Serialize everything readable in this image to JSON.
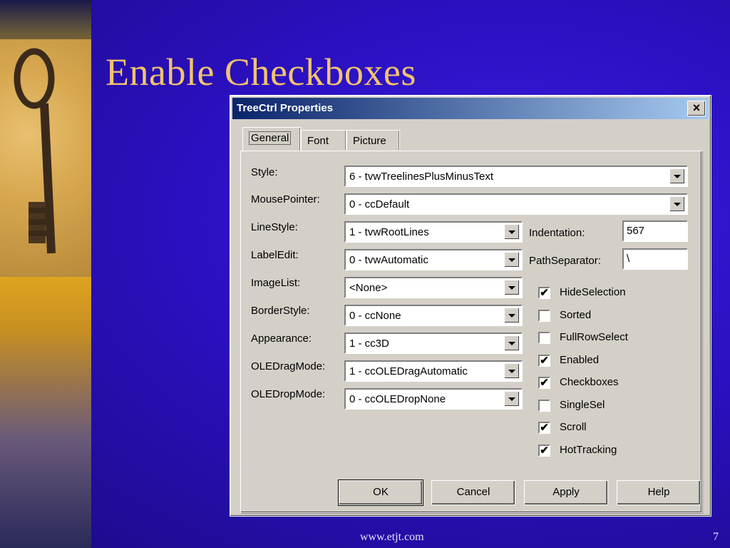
{
  "slide": {
    "title": "Enable Checkboxes",
    "footer_url": "www.etjt.com",
    "page_number": "7"
  },
  "dialog": {
    "title": "TreeCtrl Properties",
    "close_label": "×",
    "tabs": [
      {
        "label": "General",
        "active": true
      },
      {
        "label": "Font",
        "active": false
      },
      {
        "label": "Picture",
        "active": false
      }
    ],
    "fields": {
      "style": {
        "label": "Style:",
        "value": "6 - tvwTreelinesPlusMinusText"
      },
      "mousepointer": {
        "label": "MousePointer:",
        "value": "0 - ccDefault"
      },
      "linestyle": {
        "label": "LineStyle:",
        "value": "1 - tvwRootLines"
      },
      "labeledit": {
        "label": "LabelEdit:",
        "value": "0 - tvwAutomatic"
      },
      "imagelist": {
        "label": "ImageList:",
        "value": "<None>"
      },
      "borderstyle": {
        "label": "BorderStyle:",
        "value": "0 - ccNone"
      },
      "appearance": {
        "label": "Appearance:",
        "value": "1 - cc3D"
      },
      "oledragmode": {
        "label": "OLEDragMode:",
        "value": "1 - ccOLEDragAutomatic"
      },
      "oledropmode": {
        "label": "OLEDropMode:",
        "value": "0 - ccOLEDropNone"
      },
      "indentation": {
        "label": "Indentation:",
        "value": "567"
      },
      "pathseparator": {
        "label": "PathSeparator:",
        "value": "\\"
      }
    },
    "checkboxes": [
      {
        "label": "HideSelection",
        "checked": true
      },
      {
        "label": "Sorted",
        "checked": false
      },
      {
        "label": "FullRowSelect",
        "checked": false
      },
      {
        "label": "Enabled",
        "checked": true
      },
      {
        "label": "Checkboxes",
        "checked": true
      },
      {
        "label": "SingleSel",
        "checked": false
      },
      {
        "label": "Scroll",
        "checked": true
      },
      {
        "label": "HotTracking",
        "checked": true
      }
    ],
    "check_mark": "✔",
    "buttons": {
      "ok": "OK",
      "cancel": "Cancel",
      "apply": "Apply",
      "help": "Help"
    }
  }
}
